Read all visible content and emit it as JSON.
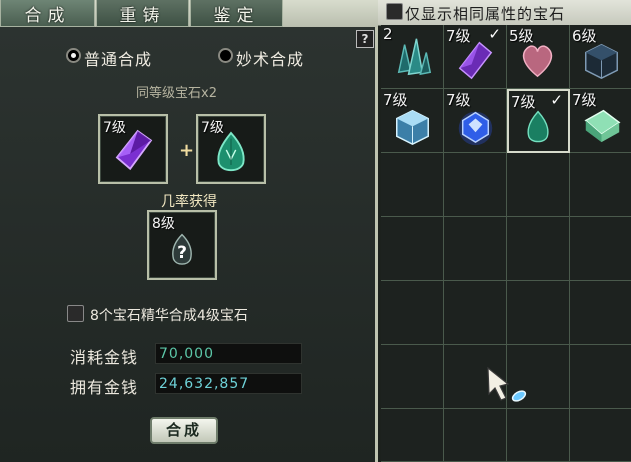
{
  "tabs": [
    {
      "label": "合成",
      "active": true
    },
    {
      "label": "重铸",
      "active": false
    },
    {
      "label": "鉴定",
      "active": false
    }
  ],
  "filter": {
    "label": "仅显示相同属性的宝石",
    "checked": false
  },
  "help_label": "?",
  "modes": {
    "normal": {
      "label": "普通合成",
      "selected": true
    },
    "magic": {
      "label": "妙术合成",
      "selected": false
    }
  },
  "requirement_label": "同等级宝石x2",
  "slot_a": {
    "level": "7级",
    "gem": "purple-gem-icon"
  },
  "plus": "+",
  "slot_b": {
    "level": "7级",
    "gem": "green-gem-icon"
  },
  "chance_label": "几率获得",
  "result": {
    "level": "8级",
    "symbol": "?"
  },
  "essence": {
    "label": "8个宝石精华合成4级宝石",
    "checked": false
  },
  "cost": {
    "label": "消耗金钱",
    "value": "70,000"
  },
  "owned": {
    "label": "拥有金钱",
    "value": "24,632,857"
  },
  "craft_button": "合成",
  "inventory": [
    {
      "level": "2",
      "checked": false,
      "gem": "teal-crystal-icon"
    },
    {
      "level": "7级",
      "checked": true,
      "gem": "purple-gem-icon"
    },
    {
      "level": "5级",
      "checked": false,
      "gem": "pink-heart-gem-icon"
    },
    {
      "level": "6级",
      "checked": false,
      "gem": "dark-cube-gem-icon"
    },
    {
      "level": "7级",
      "checked": false,
      "gem": "ice-cube-gem-icon"
    },
    {
      "level": "7级",
      "checked": false,
      "gem": "blue-round-gem-icon"
    },
    {
      "level": "7级",
      "checked": true,
      "gem": "green-gem-icon",
      "selected": true
    },
    {
      "level": "7级",
      "checked": false,
      "gem": "mint-cube-gem-icon"
    }
  ],
  "tick_mark": "✓",
  "colors": {
    "accent": "#5cc7a8",
    "money": "#6ed2d8",
    "panel": "#2c3330",
    "grid_line": "#4a5a4c"
  }
}
